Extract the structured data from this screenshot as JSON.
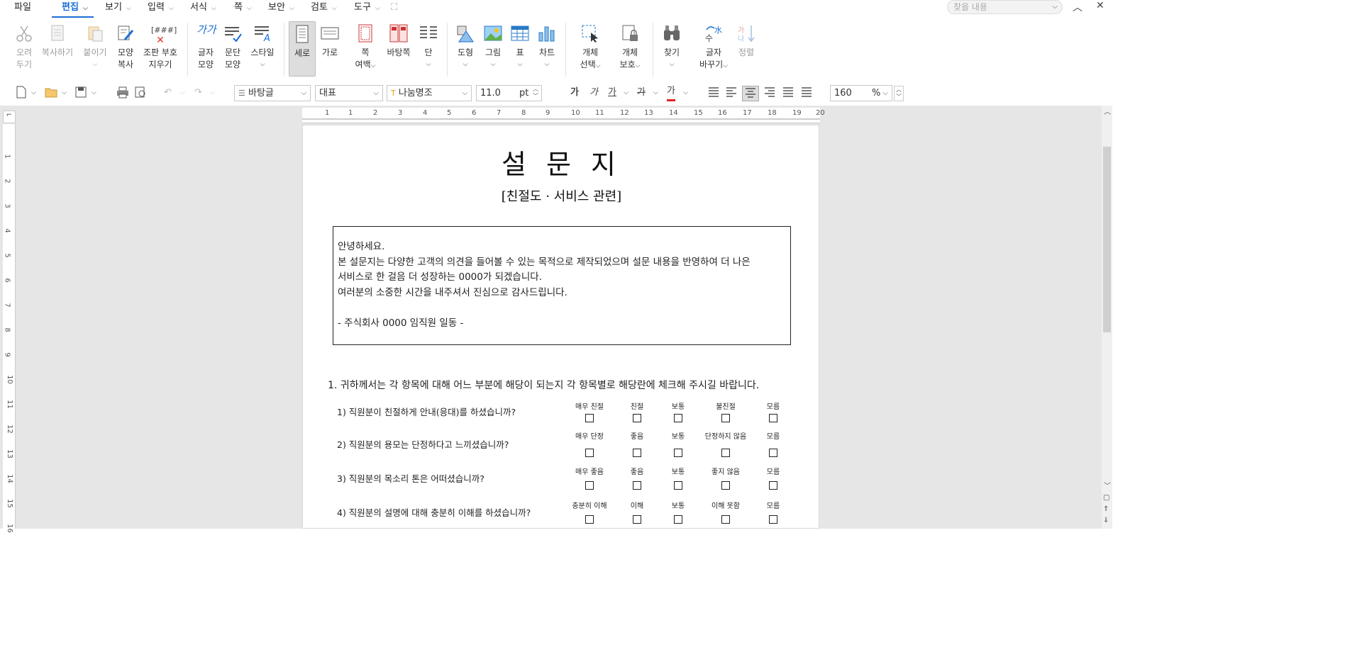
{
  "menu": {
    "file": "파일",
    "tabs": [
      "편집",
      "보기",
      "입력",
      "서식",
      "쪽",
      "보안",
      "검토",
      "도구"
    ],
    "find_placeholder": "찾을 내용"
  },
  "ribbon": {
    "cut": [
      "오려",
      "두기"
    ],
    "copy": "복사하기",
    "paste": "붙이기",
    "format_copy": [
      "모양",
      "복사"
    ],
    "clear_codes": [
      "조판 부호",
      "지우기"
    ],
    "char_shape": [
      "글자",
      "모양"
    ],
    "para_shape": [
      "문단",
      "모양"
    ],
    "style": "스타일",
    "portrait": "세로",
    "landscape": "가로",
    "page_margin": [
      "쪽",
      "여백"
    ],
    "master_page": "바탕쪽",
    "columns": "단",
    "shape": "도형",
    "picture": "그림",
    "table": "표",
    "chart": "차트",
    "object_select": [
      "개체",
      "선택"
    ],
    "object_protect": [
      "개체",
      "보호"
    ],
    "find": "찾기",
    "replace_char": [
      "글자",
      "바꾸기"
    ],
    "sort": "정렬",
    "clear_codes_glyph": "[###]",
    "char_glyph": "가가"
  },
  "toolbar": {
    "style_name": "바탕글",
    "lang": "대표",
    "font": "나눔명조",
    "size": "11.0",
    "size_unit": "pt",
    "zoom": "160",
    "zoom_unit": "%",
    "char_buttons": [
      "가",
      "가",
      "가",
      "가",
      "가"
    ]
  },
  "rulers": {
    "h": [
      "1",
      "1",
      "2",
      "3",
      "4",
      "5",
      "6",
      "7",
      "8",
      "9",
      "10",
      "11",
      "12",
      "13",
      "14",
      "15",
      "16",
      "17",
      "18",
      "19",
      "20"
    ],
    "v": [
      "1",
      "2",
      "3",
      "4",
      "5",
      "6",
      "7",
      "8",
      "9",
      "10",
      "11",
      "12",
      "13",
      "14",
      "15",
      "16"
    ]
  },
  "document": {
    "title": "설 문 지",
    "subtitle": "[친절도 · 서비스 관련]",
    "intro": [
      "안녕하세요.",
      "본 설문지는 다양한 고객의 의견을 들어볼 수 있는 목적으로 제작되었으며 설문 내용을 반영하여 더 나은",
      "서비스로 한 걸음 더 성장하는 0000가 되겠습니다.",
      "여러분의 소중한 시간을 내주셔서 진심으로 감사드립니다.",
      "",
      "- 주식회사 0000 임직원 일동 -"
    ],
    "question1": "1. 귀하께서는 각 항목에 대해 어느 부분에 해당이 되는지 각 항목별로 해당란에 체크해 주시길 바랍니다.",
    "items": [
      {
        "q": "1)   직원분이 친절하게 안내(응대)를 하셨습니까?",
        "opts": [
          "매우 친절",
          "친절",
          "보통",
          "불친절",
          "모름"
        ]
      },
      {
        "q": "2)   직원분의 용모는 단정하다고 느끼셨습니까?",
        "opts": [
          "매우 단정",
          "좋음",
          "보통",
          "단정하지 않음",
          "모름"
        ]
      },
      {
        "q": "3)   직원분의 목소리 톤은 어떠셨습니까?",
        "opts": [
          "매우 좋음",
          "좋음",
          "보통",
          "좋지 않음",
          "모름"
        ]
      },
      {
        "q": "4)   직원분의 설명에 대해 충분히 이해를 하셨습니까?",
        "opts": [
          "충분히 이해",
          "이해",
          "보통",
          "이해 못함",
          "모름"
        ]
      }
    ]
  }
}
